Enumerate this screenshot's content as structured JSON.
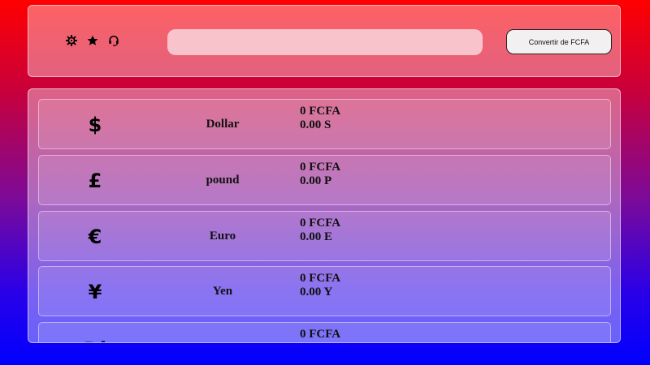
{
  "header": {
    "icons": [
      "gear-icon",
      "star-icon",
      "headset-icon"
    ],
    "search_value": "",
    "search_placeholder": "",
    "convert_label": "Convertir de FCFA"
  },
  "currencies": [
    {
      "symbol": "$",
      "name": "Dollar",
      "fcfa": "0 FCFA",
      "converted": "0.00 S"
    },
    {
      "symbol": "£",
      "name": "pound",
      "fcfa": "0 FCFA",
      "converted": "0.00 P"
    },
    {
      "symbol": "€",
      "name": "Euro",
      "fcfa": "0 FCFA",
      "converted": "0.00 E"
    },
    {
      "symbol": "¥",
      "name": "Yen",
      "fcfa": "0 FCFA",
      "converted": "0.00 Y"
    },
    {
      "symbol": "Di",
      "name": "",
      "fcfa": "0 FCFA",
      "converted": ""
    }
  ],
  "colors": {
    "gradient_top": "#ff0000",
    "gradient_bottom": "#0000ff",
    "search_bg": "#f9c3cc",
    "button_bg": "#f2f0f0"
  }
}
